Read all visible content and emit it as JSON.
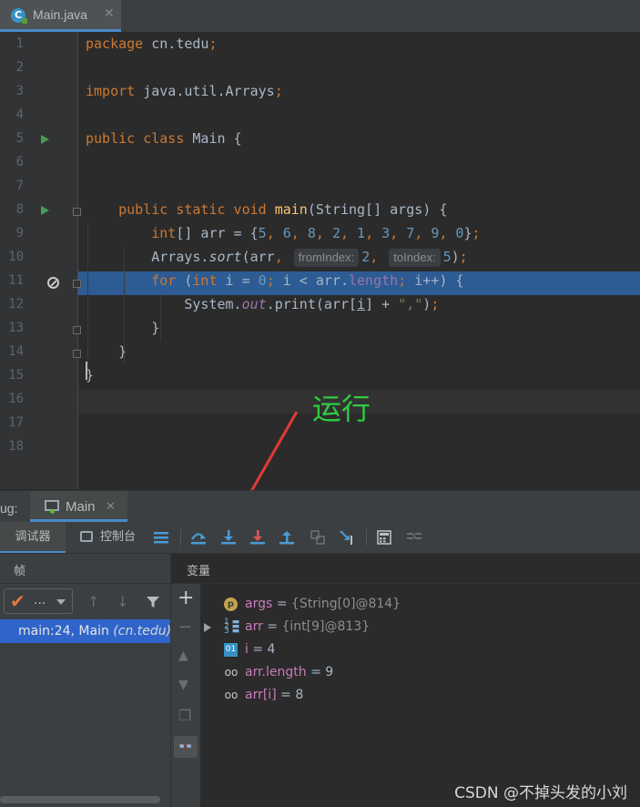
{
  "tab": {
    "file_name": "Main.java",
    "icon_letter": "C"
  },
  "editor": {
    "line_numbers": [
      "1",
      "2",
      "3",
      "4",
      "5",
      "6",
      "7",
      "8",
      "9",
      "10",
      "11",
      "12",
      "13",
      "14",
      "15",
      "16",
      "17",
      "18"
    ],
    "current_line": "11"
  },
  "annotation": {
    "text": "运行"
  },
  "debug": {
    "panel_label": "ug:",
    "run_tab_label": "Main",
    "toolbar": {
      "debugger_tab": "调试器",
      "console_tab": "控制台"
    },
    "frames": {
      "title": "帧",
      "thread_value": "...",
      "frame_name": "main:24, Main",
      "frame_package": "(cn.tedu)"
    },
    "variables": {
      "title": "变量",
      "items": [
        {
          "icon": "parameter-icon",
          "name": "args",
          "value": "{String[0]@814}"
        },
        {
          "icon": "array-icon",
          "name": "arr",
          "value": "{int[9]@813}"
        },
        {
          "icon": "primitive-icon",
          "name": "i",
          "value": "4"
        },
        {
          "icon": "watch-icon",
          "name": "arr.length",
          "value": "9"
        },
        {
          "icon": "watch-icon",
          "name": "arr[i]",
          "value": "8"
        }
      ]
    }
  },
  "watermark": "CSDN @不掉头发的小刘",
  "colors": {
    "accent": "#4a88c7",
    "execution_line": "#2d5b93",
    "annotation": "#2ecc40",
    "arrow": "#e53935"
  }
}
